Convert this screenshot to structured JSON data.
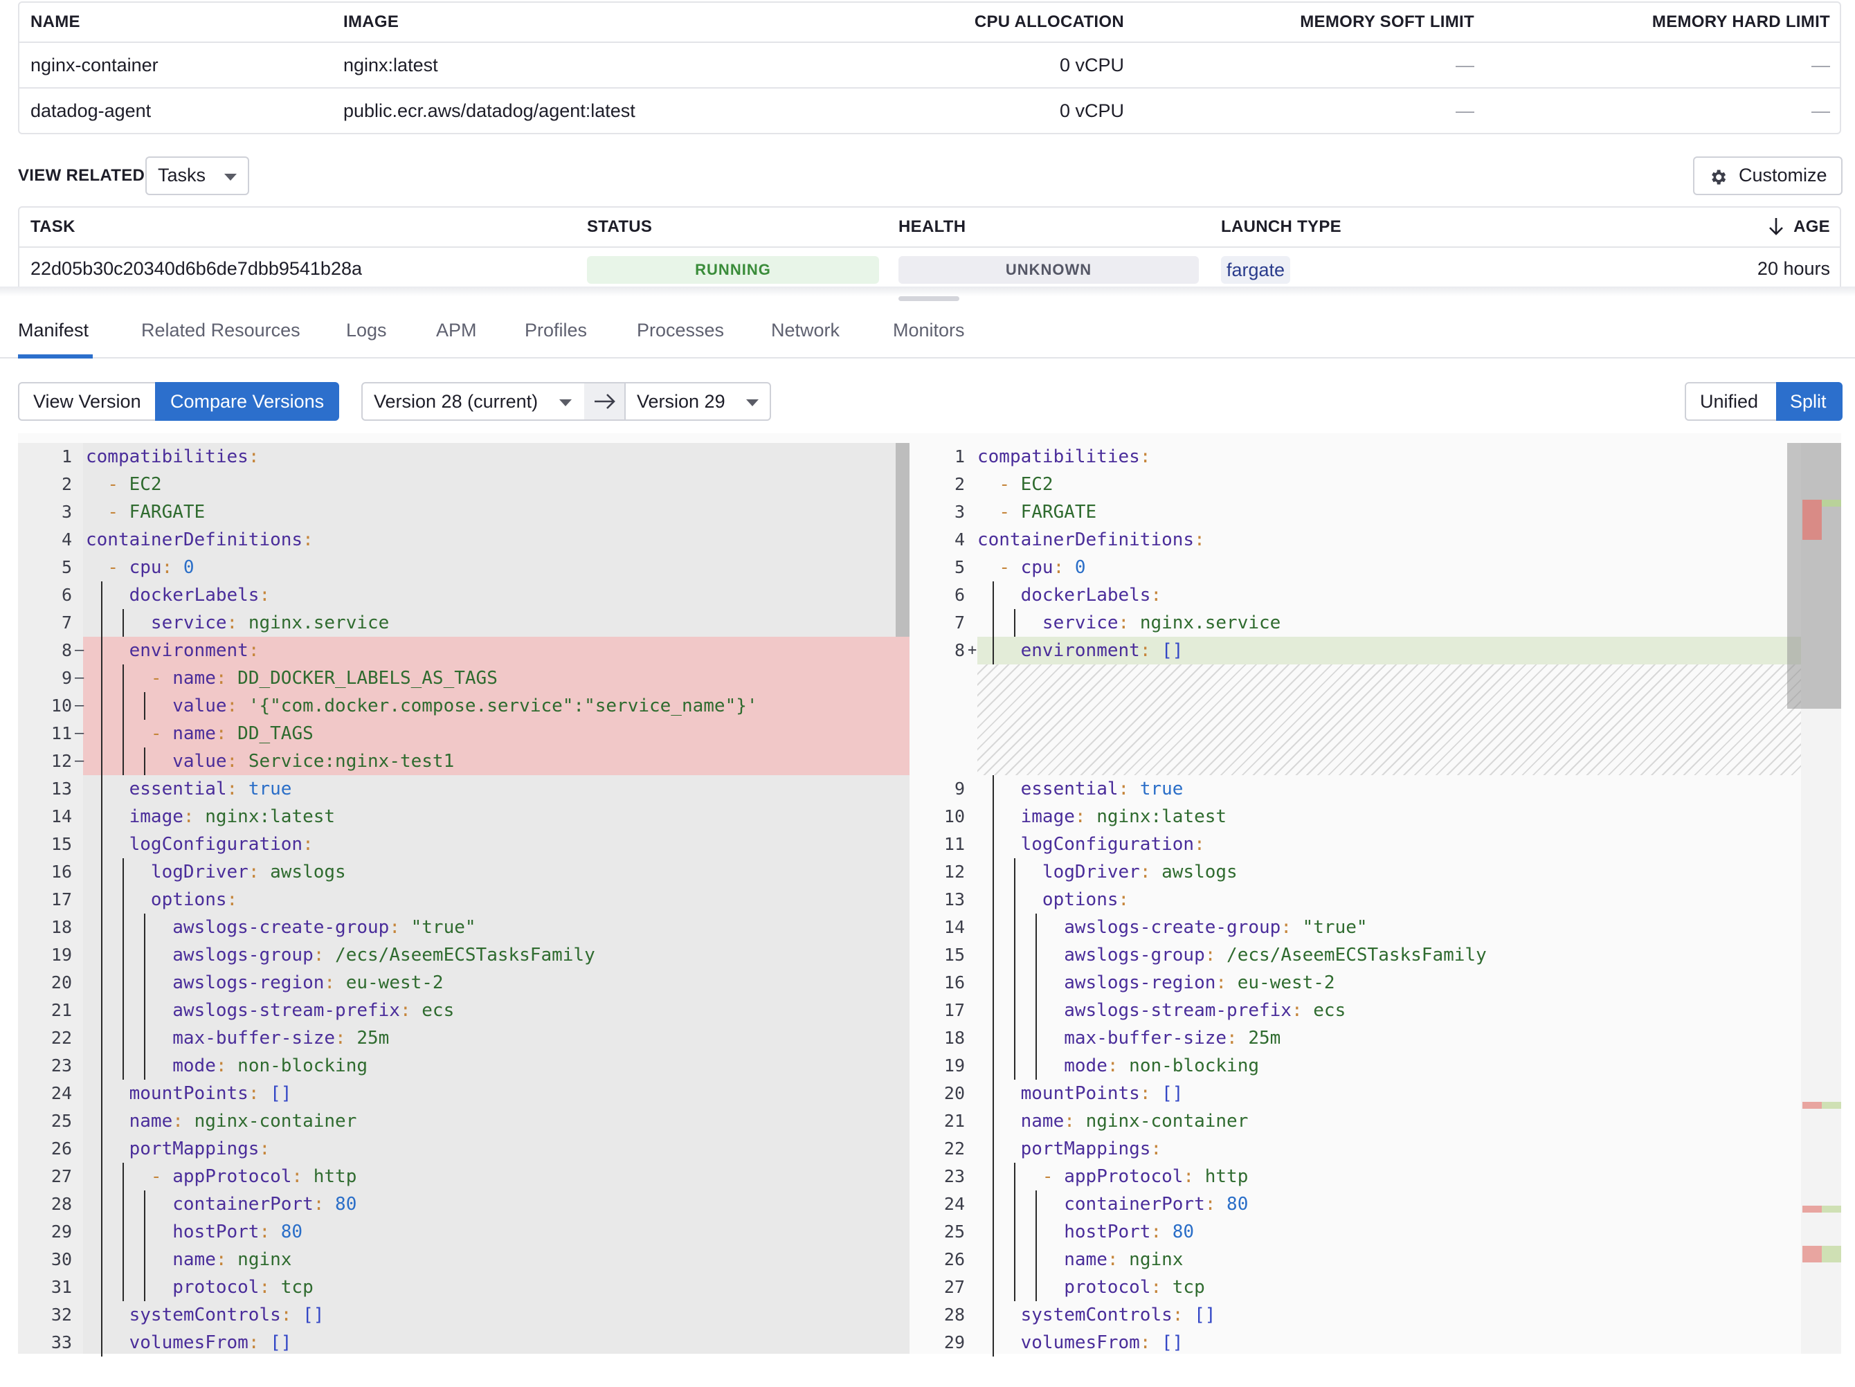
{
  "containers": {
    "headers": [
      "NAME",
      "IMAGE",
      "CPU ALLOCATION",
      "MEMORY SOFT LIMIT",
      "MEMORY HARD LIMIT"
    ],
    "rows": [
      {
        "name": "nginx-container",
        "image": "nginx:latest",
        "cpu": "0 vCPU",
        "soft": "—",
        "hard": "—"
      },
      {
        "name": "datadog-agent",
        "image": "public.ecr.aws/datadog/agent:latest",
        "cpu": "0 vCPU",
        "soft": "—",
        "hard": "—"
      }
    ]
  },
  "view_related": {
    "label": "VIEW RELATED",
    "selected": "Tasks",
    "customize_label": "Customize"
  },
  "tasks": {
    "headers": [
      "TASK",
      "STATUS",
      "HEALTH",
      "LAUNCH TYPE",
      "AGE"
    ],
    "rows": [
      {
        "task": "22d05b30c20340d6b6de7dbb9541b28a",
        "status": "RUNNING",
        "health": "UNKNOWN",
        "launch_type": "fargate",
        "age": "20 hours"
      }
    ]
  },
  "tabs": [
    "Manifest",
    "Related Resources",
    "Logs",
    "APM",
    "Profiles",
    "Processes",
    "Network",
    "Monitors"
  ],
  "toolbar": {
    "view_version": "View Version",
    "compare_versions": "Compare Versions",
    "version_left": "Version 28 (current)",
    "version_right": "Version 29",
    "unified": "Unified",
    "split": "Split"
  },
  "colors": {
    "accent": "#2c6fcc",
    "removed_bg": "#f1c8c8",
    "added_bg": "#e3ecd8",
    "running_bg": "#e8f5e8",
    "unknown_bg": "#ededf2"
  },
  "diff_left": [
    {
      "n": "1",
      "t": "compatibilities:"
    },
    {
      "n": "2",
      "t": "  - EC2"
    },
    {
      "n": "3",
      "t": "  - FARGATE"
    },
    {
      "n": "4",
      "t": "containerDefinitions:"
    },
    {
      "n": "5",
      "t": "  - cpu: 0"
    },
    {
      "n": "6",
      "t": "    dockerLabels:"
    },
    {
      "n": "7",
      "t": "      service: nginx.service"
    },
    {
      "n": "8",
      "t": "    environment:",
      "mark": "removed"
    },
    {
      "n": "9",
      "t": "      - name: DD_DOCKER_LABELS_AS_TAGS",
      "mark": "removed"
    },
    {
      "n": "10",
      "t": "        value: '{\"com.docker.compose.service\":\"service_name\"}'",
      "mark": "removed"
    },
    {
      "n": "11",
      "t": "      - name: DD_TAGS",
      "mark": "removed"
    },
    {
      "n": "12",
      "t": "        value: Service:nginx-test1",
      "mark": "removed"
    },
    {
      "n": "13",
      "t": "    essential: true"
    },
    {
      "n": "14",
      "t": "    image: nginx:latest"
    },
    {
      "n": "15",
      "t": "    logConfiguration:"
    },
    {
      "n": "16",
      "t": "      logDriver: awslogs"
    },
    {
      "n": "17",
      "t": "      options:"
    },
    {
      "n": "18",
      "t": "        awslogs-create-group: \"true\""
    },
    {
      "n": "19",
      "t": "        awslogs-group: /ecs/AseemECSTasksFamily"
    },
    {
      "n": "20",
      "t": "        awslogs-region: eu-west-2"
    },
    {
      "n": "21",
      "t": "        awslogs-stream-prefix: ecs"
    },
    {
      "n": "22",
      "t": "        max-buffer-size: 25m"
    },
    {
      "n": "23",
      "t": "        mode: non-blocking"
    },
    {
      "n": "24",
      "t": "    mountPoints: []"
    },
    {
      "n": "25",
      "t": "    name: nginx-container"
    },
    {
      "n": "26",
      "t": "    portMappings:"
    },
    {
      "n": "27",
      "t": "      - appProtocol: http"
    },
    {
      "n": "28",
      "t": "        containerPort: 80"
    },
    {
      "n": "29",
      "t": "        hostPort: 80"
    },
    {
      "n": "30",
      "t": "        name: nginx"
    },
    {
      "n": "31",
      "t": "        protocol: tcp"
    },
    {
      "n": "32",
      "t": "    systemControls: []"
    },
    {
      "n": "33",
      "t": "    volumesFrom: []"
    }
  ],
  "diff_right": [
    {
      "n": "1",
      "t": "compatibilities:"
    },
    {
      "n": "2",
      "t": "  - EC2"
    },
    {
      "n": "3",
      "t": "  - FARGATE"
    },
    {
      "n": "4",
      "t": "containerDefinitions:"
    },
    {
      "n": "5",
      "t": "  - cpu: 0"
    },
    {
      "n": "6",
      "t": "    dockerLabels:"
    },
    {
      "n": "7",
      "t": "      service: nginx.service"
    },
    {
      "n": "8",
      "t": "    environment: []",
      "mark": "added"
    },
    {
      "n": "",
      "t": "",
      "mark": "gap"
    },
    {
      "n": "",
      "t": "",
      "mark": "gap"
    },
    {
      "n": "",
      "t": "",
      "mark": "gap"
    },
    {
      "n": "",
      "t": "",
      "mark": "gap"
    },
    {
      "n": "9",
      "t": "    essential: true"
    },
    {
      "n": "10",
      "t": "    image: nginx:latest"
    },
    {
      "n": "11",
      "t": "    logConfiguration:"
    },
    {
      "n": "12",
      "t": "      logDriver: awslogs"
    },
    {
      "n": "13",
      "t": "      options:"
    },
    {
      "n": "14",
      "t": "        awslogs-create-group: \"true\""
    },
    {
      "n": "15",
      "t": "        awslogs-group: /ecs/AseemECSTasksFamily"
    },
    {
      "n": "16",
      "t": "        awslogs-region: eu-west-2"
    },
    {
      "n": "17",
      "t": "        awslogs-stream-prefix: ecs"
    },
    {
      "n": "18",
      "t": "        max-buffer-size: 25m"
    },
    {
      "n": "19",
      "t": "        mode: non-blocking"
    },
    {
      "n": "20",
      "t": "    mountPoints: []"
    },
    {
      "n": "21",
      "t": "    name: nginx-container"
    },
    {
      "n": "22",
      "t": "    portMappings:"
    },
    {
      "n": "23",
      "t": "      - appProtocol: http"
    },
    {
      "n": "24",
      "t": "        containerPort: 80"
    },
    {
      "n": "25",
      "t": "        hostPort: 80"
    },
    {
      "n": "26",
      "t": "        name: nginx"
    },
    {
      "n": "27",
      "t": "        protocol: tcp"
    },
    {
      "n": "28",
      "t": "    systemControls: []"
    },
    {
      "n": "29",
      "t": "    volumesFrom: []"
    }
  ]
}
